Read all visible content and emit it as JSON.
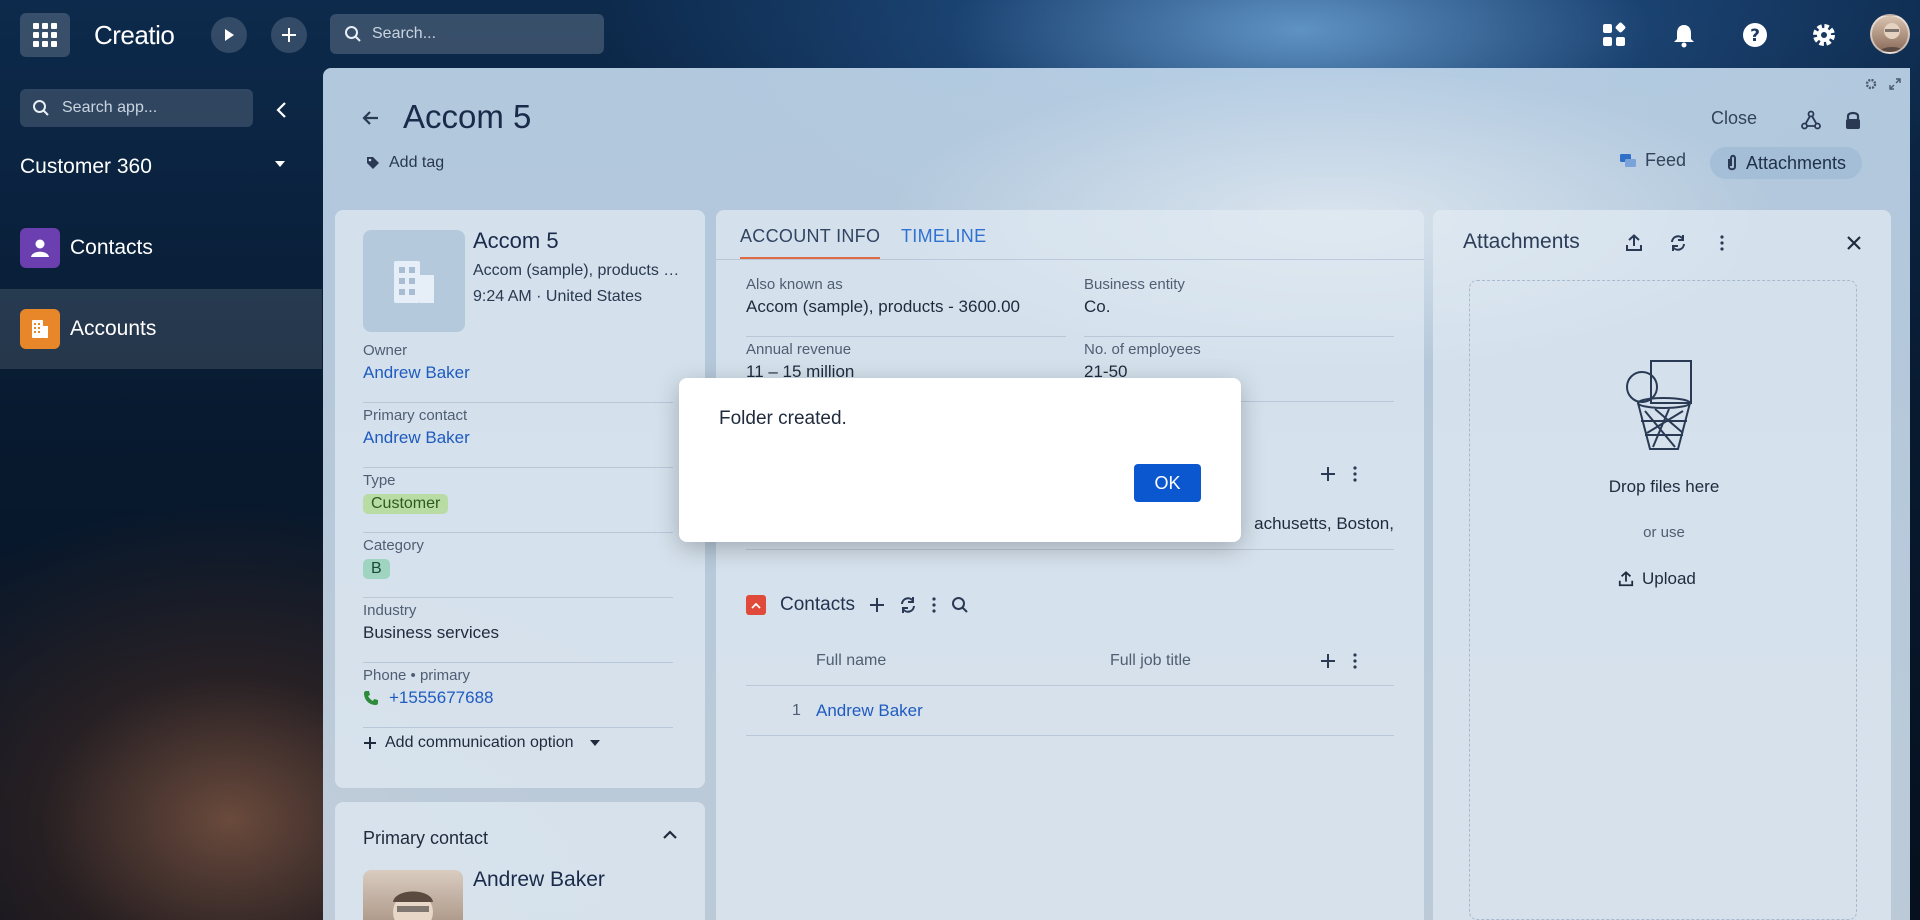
{
  "topbar": {
    "logo": "Creatio",
    "search_placeholder": "Search..."
  },
  "sidebar": {
    "search_placeholder": "Search app...",
    "workspace": "Customer 360",
    "items": [
      {
        "label": "Contacts",
        "color": "#6b3fb0"
      },
      {
        "label": "Accounts",
        "color": "#e8862a"
      }
    ]
  },
  "header": {
    "title": "Accom 5",
    "add_tag": "Add tag",
    "close": "Close",
    "feed": "Feed",
    "attachments": "Attachments"
  },
  "account": {
    "name": "Accom 5",
    "subtitle": "Accom (sample), products - 3600.00",
    "time_location": "9:24 AM · United States",
    "fields": [
      {
        "label": "Owner",
        "value": "Andrew Baker"
      },
      {
        "label": "Primary contact",
        "value": "Andrew Baker"
      },
      {
        "label": "Type",
        "value": "Customer"
      },
      {
        "label": "Category",
        "value": "B"
      },
      {
        "label": "Industry",
        "value": "Business services"
      },
      {
        "label": "Phone • primary",
        "value": "+1555677688"
      }
    ],
    "add_communication": "Add communication option"
  },
  "primary_contact": {
    "title": "Primary contact",
    "name": "Andrew Baker"
  },
  "tabs": [
    "ACCOUNT INFO",
    "TIMELINE"
  ],
  "account_info": {
    "fields": [
      {
        "label": "Also known as",
        "value": "Accom (sample), products - 3600.00"
      },
      {
        "label": "Business entity",
        "value": "Co."
      },
      {
        "label": "Annual revenue",
        "value": "11 – 15 million"
      },
      {
        "label": "No. of employees",
        "value": "21-50"
      }
    ],
    "address_fragment": "achusetts, Boston,"
  },
  "contacts_table": {
    "title": "Contacts",
    "columns": [
      "Full name",
      "Full job title"
    ],
    "rows": [
      {
        "num": "1",
        "name": "Andrew Baker"
      }
    ]
  },
  "attachments_panel": {
    "title": "Attachments",
    "drop_text": "Drop files here",
    "or_text": "or use",
    "upload": "Upload"
  },
  "dialog": {
    "message": "Folder created.",
    "ok": "OK"
  }
}
